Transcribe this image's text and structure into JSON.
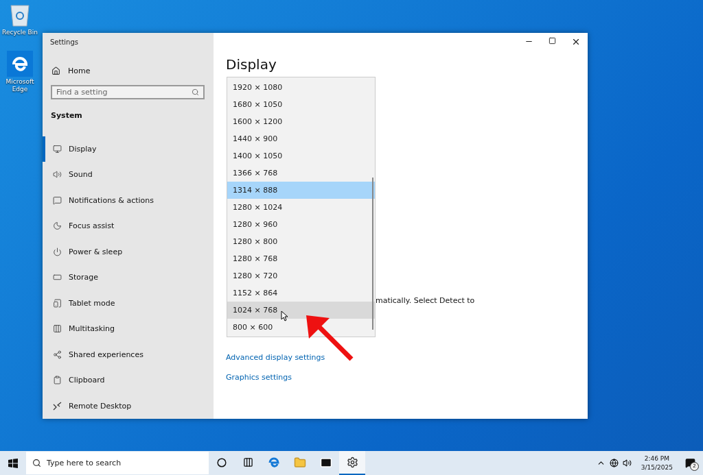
{
  "desktop": {
    "icons": [
      {
        "label": "Recycle Bin",
        "kind": "bin"
      },
      {
        "label": "Microsoft Edge",
        "kind": "edge"
      }
    ]
  },
  "window": {
    "title": "Settings",
    "sidebar": {
      "home": "Home",
      "search": {
        "placeholder": "Find a setting"
      },
      "section": "System",
      "items": [
        {
          "label": "Display",
          "kind": "monitor",
          "selected": true
        },
        {
          "label": "Sound",
          "kind": "sound",
          "selected": false
        },
        {
          "label": "Notifications & actions",
          "kind": "message",
          "selected": false
        },
        {
          "label": "Focus assist",
          "kind": "moon",
          "selected": false
        },
        {
          "label": "Power & sleep",
          "kind": "power",
          "selected": false
        },
        {
          "label": "Storage",
          "kind": "storage",
          "selected": false
        },
        {
          "label": "Tablet mode",
          "kind": "tablet",
          "selected": false
        },
        {
          "label": "Multitasking",
          "kind": "multi",
          "selected": false
        },
        {
          "label": "Shared experiences",
          "kind": "share",
          "selected": false
        },
        {
          "label": "Clipboard",
          "kind": "clipboard",
          "selected": false
        },
        {
          "label": "Remote Desktop",
          "kind": "remote",
          "selected": false
        }
      ]
    },
    "content": {
      "heading": "Display",
      "description": "matically. Select Detect to",
      "links": [
        "Advanced display settings",
        "Graphics settings"
      ]
    },
    "dropdown": {
      "options": [
        {
          "label": "1920 × 1080",
          "selected": false,
          "hovered": false
        },
        {
          "label": "1680 × 1050",
          "selected": false,
          "hovered": false
        },
        {
          "label": "1600 × 1200",
          "selected": false,
          "hovered": false
        },
        {
          "label": "1440 × 900",
          "selected": false,
          "hovered": false
        },
        {
          "label": "1400 × 1050",
          "selected": false,
          "hovered": false
        },
        {
          "label": "1366 × 768",
          "selected": false,
          "hovered": false
        },
        {
          "label": "1314 × 888",
          "selected": true,
          "hovered": false
        },
        {
          "label": "1280 × 1024",
          "selected": false,
          "hovered": false
        },
        {
          "label": "1280 × 960",
          "selected": false,
          "hovered": false
        },
        {
          "label": "1280 × 800",
          "selected": false,
          "hovered": false
        },
        {
          "label": "1280 × 768",
          "selected": false,
          "hovered": false
        },
        {
          "label": "1280 × 720",
          "selected": false,
          "hovered": false
        },
        {
          "label": "1152 × 864",
          "selected": false,
          "hovered": false
        },
        {
          "label": "1024 × 768",
          "selected": false,
          "hovered": true
        },
        {
          "label": "800 × 600",
          "selected": false,
          "hovered": false
        }
      ]
    }
  },
  "taskbar": {
    "search": {
      "placeholder": "Type here to search"
    },
    "apps": [
      {
        "kind": "cortana",
        "active": false
      },
      {
        "kind": "taskview",
        "active": false
      },
      {
        "kind": "edge",
        "active": false
      },
      {
        "kind": "folder",
        "active": false
      },
      {
        "kind": "mail",
        "active": false
      },
      {
        "kind": "settings",
        "active": true
      }
    ],
    "time": "2:46 PM",
    "date": "3/15/2025",
    "notifications": "2"
  }
}
